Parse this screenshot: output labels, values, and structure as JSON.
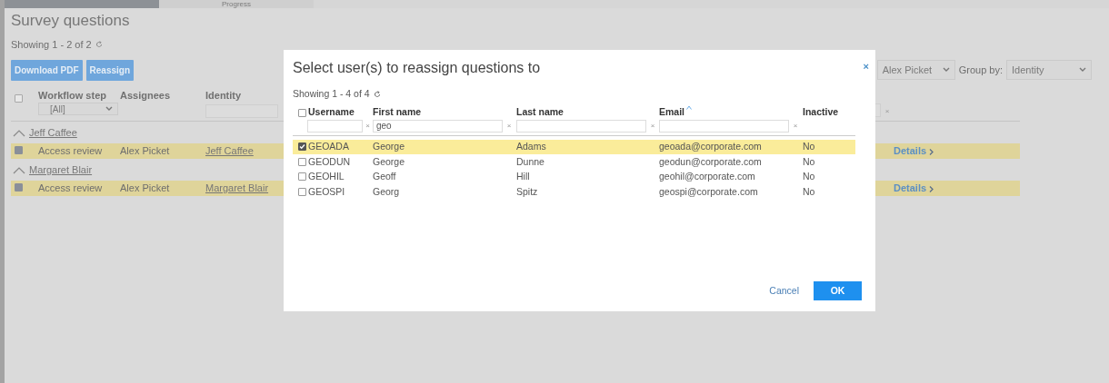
{
  "background": {
    "tabs": [
      {
        "selected": true
      },
      {
        "label": "Progress",
        "selected": false
      }
    ],
    "title": "Survey questions",
    "showing": "Showing 1 - 2 of 2",
    "buttons": [
      "Download PDF",
      "Reassign"
    ],
    "select_all_checked": false,
    "clear_filter": "×",
    "assignee_select": "Alex Picket",
    "group_by_label": "Group by:",
    "group_by_select": "Identity",
    "columns": [
      "Workflow step",
      "Assignees",
      "Identity"
    ],
    "workflow_filter": "[All]",
    "groups": [
      {
        "name": "Jeff Caffee",
        "expanded": true,
        "rows": [
          {
            "checked": true,
            "workflow_step": "Access review",
            "assignee": "Alex Picket",
            "identity": "Jeff Caffee",
            "link": "Details"
          }
        ]
      },
      {
        "name": "Margaret Blair",
        "expanded": true,
        "rows": [
          {
            "checked": true,
            "workflow_step": "Access review",
            "assignee": "Alex Picket",
            "identity": "Margaret Blair",
            "link": "Details"
          }
        ]
      }
    ]
  },
  "dialog": {
    "title": "Select user(s) to reassign questions to",
    "close": "×",
    "showing": "Showing 1 - 4 of 4",
    "select_all_checked": false,
    "columns": [
      {
        "label": "Username",
        "filter": true,
        "clear": "×",
        "sorted": false
      },
      {
        "label": "First name",
        "filter": true,
        "filter_value": "geo",
        "clear": "×",
        "sorted": false
      },
      {
        "label": "Last name",
        "filter": true,
        "clear": "×",
        "sorted": false
      },
      {
        "label": "Email",
        "filter": true,
        "clear": "×",
        "sorted": true
      },
      {
        "label": "Inactive",
        "filter": false,
        "sorted": false
      }
    ],
    "rows": [
      {
        "checked": true,
        "cells": [
          "GEOADA",
          "George",
          "Adams",
          "geoada@corporate.com",
          "No"
        ]
      },
      {
        "checked": false,
        "cells": [
          "GEODUN",
          "George",
          "Dunne",
          "geodun@corporate.com",
          "No"
        ]
      },
      {
        "checked": false,
        "cells": [
          "GEOHIL",
          "Geoff",
          "Hill",
          "geohil@corporate.com",
          "No"
        ]
      },
      {
        "checked": false,
        "cells": [
          "GEOSPI",
          "Georg",
          "Spitz",
          "geospi@corporate.com",
          "No"
        ]
      }
    ],
    "buttons": {
      "cancel": "Cancel",
      "ok": "OK"
    }
  }
}
